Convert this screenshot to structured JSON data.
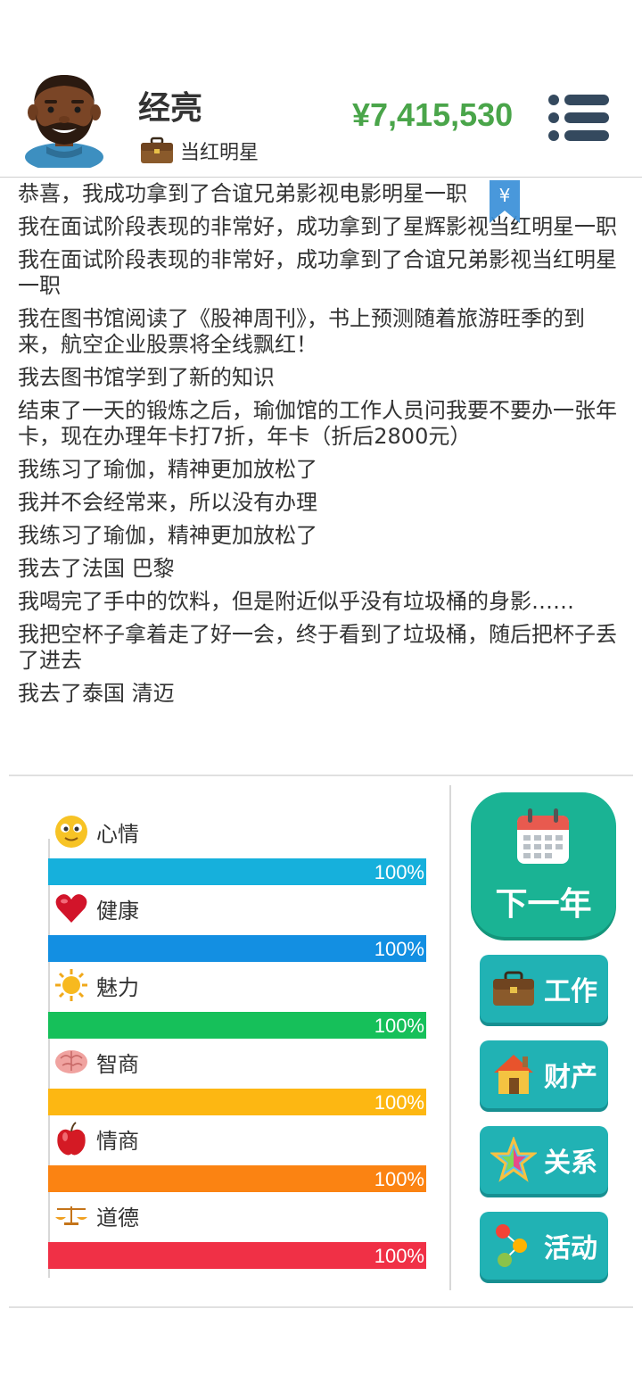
{
  "player": {
    "name": "经亮",
    "job": "当红明星",
    "money": "¥7,415,530"
  },
  "log": [
    "恭喜，我成功拿到了合谊兄弟影视电影明星一职",
    "我在面试阶段表现的非常好，成功拿到了星辉影视当红明星一职",
    "我在面试阶段表现的非常好，成功拿到了合谊兄弟影视当红明星一职",
    "我在图书馆阅读了《股神周刊》，书上预测随着旅游旺季的到来，航空企业股票将全线飘红！",
    "我去图书馆学到了新的知识",
    "结束了一天的锻炼之后，瑜伽馆的工作人员问我要不要办一张年卡，现在办理年卡打7折，年卡（折后2800元）",
    "我练习了瑜伽，精神更加放松了",
    "我并不会经常来，所以没有办理",
    "我练习了瑜伽，精神更加放松了",
    "我去了法国 巴黎",
    "我喝完了手中的饮料，但是附近似乎没有垃圾桶的身影……",
    "我把空杯子拿着走了好一会，终于看到了垃圾桶，随后把杯子丢了进去",
    "我去了泰国 清迈"
  ],
  "bookmark_icon": "yen-bookmark-icon",
  "stats": [
    {
      "label": "心情",
      "percent": 100,
      "display": "100%",
      "color": "#16b0dc",
      "icon": "smiley-icon"
    },
    {
      "label": "健康",
      "percent": 100,
      "display": "100%",
      "color": "#138fe2",
      "icon": "heart-icon"
    },
    {
      "label": "魅力",
      "percent": 100,
      "display": "100%",
      "color": "#16c05a",
      "icon": "sun-icon"
    },
    {
      "label": "智商",
      "percent": 100,
      "display": "100%",
      "color": "#fdb712",
      "icon": "brain-icon"
    },
    {
      "label": "情商",
      "percent": 100,
      "display": "100%",
      "color": "#fb8312",
      "icon": "apple-icon"
    },
    {
      "label": "道德",
      "percent": 100,
      "display": "100%",
      "color": "#f03046",
      "icon": "scale-icon"
    }
  ],
  "actions": {
    "next_year": "下一年",
    "work": "工作",
    "property": "财产",
    "relations": "关系",
    "activities": "活动"
  },
  "colors": {
    "money": "#4aa54a",
    "primary_button": "#1ab394",
    "side_button": "#21b2b4"
  }
}
